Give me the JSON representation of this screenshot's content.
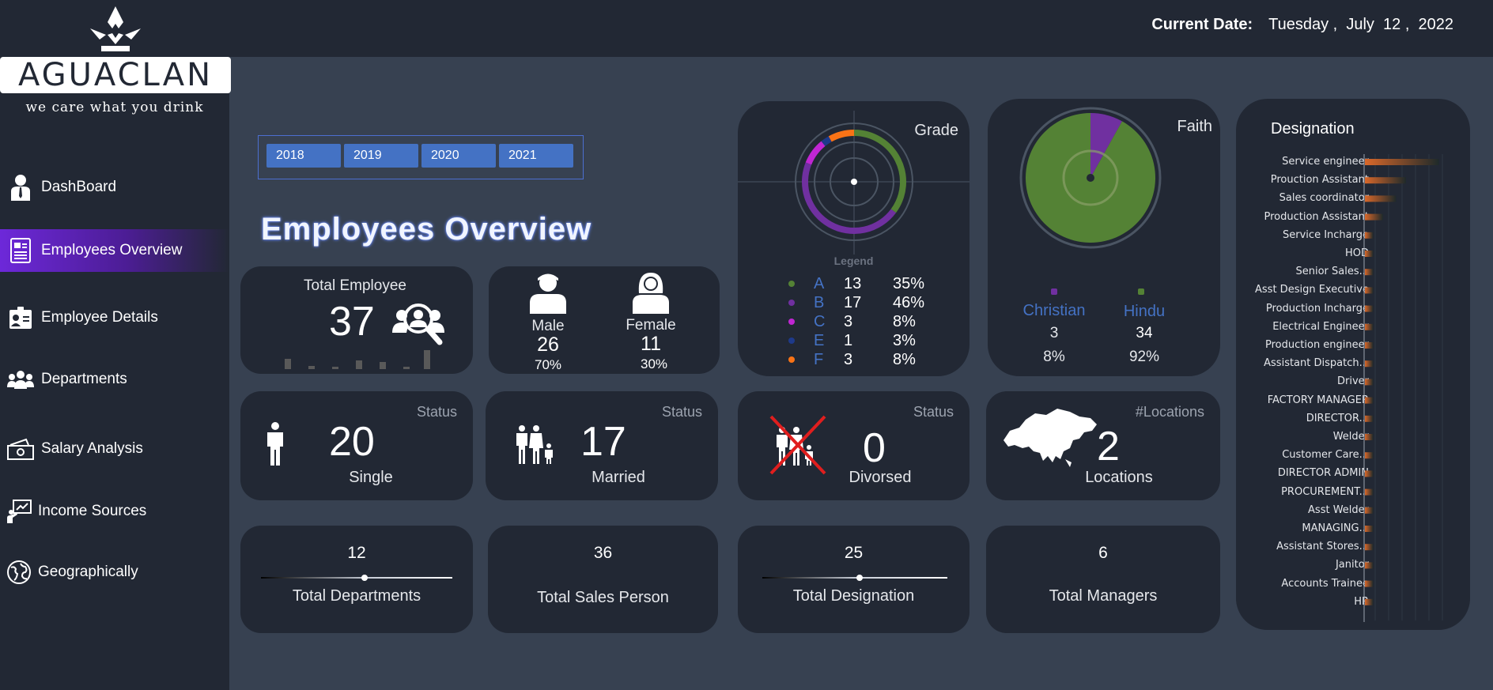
{
  "brand": {
    "name": "AGUACLAN",
    "tagline": "we care what you drink"
  },
  "header": {
    "date_label": "Current Date:",
    "date_value": "Tuesday ,  July  12 ,  2022"
  },
  "nav": [
    {
      "label": "DashBoard",
      "icon": "manager-icon"
    },
    {
      "label": "Employees Overview",
      "icon": "document-icon"
    },
    {
      "label": "Employee Details",
      "icon": "id-card-icon"
    },
    {
      "label": "Departments",
      "icon": "group-icon"
    },
    {
      "label": "Salary Analysis",
      "icon": "money-icon"
    },
    {
      "label": "Income Sources",
      "icon": "presentation-icon"
    },
    {
      "label": "Geographically",
      "icon": "globe-icon"
    }
  ],
  "years": [
    "2018",
    "2019",
    "2020",
    "2021"
  ],
  "page_title": "Employees Overview",
  "total_employee": {
    "label": "Total Employee",
    "value": "37"
  },
  "gender": {
    "male": {
      "label": "Male",
      "count": "26",
      "pct": "70%"
    },
    "female": {
      "label": "Female",
      "count": "11",
      "pct": "30%"
    }
  },
  "grade": {
    "title": "Grade",
    "legend_title": "Legend",
    "rows": [
      {
        "grade": "A",
        "count": "13",
        "pct": "35%",
        "color": "#548235"
      },
      {
        "grade": "B",
        "count": "17",
        "pct": "46%",
        "color": "#7030a0"
      },
      {
        "grade": "C",
        "count": "3",
        "pct": "8%",
        "color": "#c026d3"
      },
      {
        "grade": "E",
        "count": "1",
        "pct": "3%",
        "color": "#1e3a8a"
      },
      {
        "grade": "F",
        "count": "3",
        "pct": "8%",
        "color": "#f97316"
      }
    ]
  },
  "faith": {
    "title": "Faith",
    "items": [
      {
        "name": "Christian",
        "count": "3",
        "pct": "8%",
        "color": "#7030a0"
      },
      {
        "name": "Hindu",
        "count": "34",
        "pct": "92%",
        "color": "#548235"
      }
    ]
  },
  "status_cards": [
    {
      "status_label": "Status",
      "value": "20",
      "caption": "Single"
    },
    {
      "status_label": "Status",
      "value": "17",
      "caption": "Married"
    },
    {
      "status_label": "Status",
      "value": "0",
      "caption": "Divorsed"
    },
    {
      "status_label": "#Locations",
      "value": "2",
      "caption": "Locations"
    }
  ],
  "totals": [
    {
      "value": "12",
      "caption": "Total Departments"
    },
    {
      "value": "36",
      "caption": "Total Sales Person"
    },
    {
      "value": "25",
      "caption": "Total Designation"
    },
    {
      "value": "6",
      "caption": "Total Managers"
    }
  ],
  "designation": {
    "title": "Designation",
    "items": [
      {
        "name": "Service engineer",
        "value": 0.9
      },
      {
        "name": "Prouction Assistant",
        "value": 0.5
      },
      {
        "name": "Sales coordinator",
        "value": 0.38
      },
      {
        "name": "Production Assistant",
        "value": 0.22
      },
      {
        "name": "Service Incharge",
        "value": 0.1
      },
      {
        "name": "HOD",
        "value": 0.1
      },
      {
        "name": "Senior Sales...",
        "value": 0.1
      },
      {
        "name": "Asst Design Executive",
        "value": 0.1
      },
      {
        "name": "Production Incharge",
        "value": 0.1
      },
      {
        "name": "Electrical Engineer",
        "value": 0.1
      },
      {
        "name": "Production engineer",
        "value": 0.1
      },
      {
        "name": "Assistant Dispatch...",
        "value": 0.1
      },
      {
        "name": "Driver",
        "value": 0.1
      },
      {
        "name": "FACTORY MANAGER",
        "value": 0.1
      },
      {
        "name": "DIRECTOR...",
        "value": 0.1
      },
      {
        "name": "Welder",
        "value": 0.1
      },
      {
        "name": "Customer Care...",
        "value": 0.1
      },
      {
        "name": "DIRECTOR ADMIN",
        "value": 0.1
      },
      {
        "name": "PROCUREMENT...",
        "value": 0.1
      },
      {
        "name": "Asst Welder",
        "value": 0.1
      },
      {
        "name": "MANAGING...",
        "value": 0.1
      },
      {
        "name": "Assistant Stores...",
        "value": 0.1
      },
      {
        "name": "Janitor",
        "value": 0.1
      },
      {
        "name": "Accounts Trainee",
        "value": 0.1
      },
      {
        "name": "HR",
        "value": 0.1
      }
    ]
  }
}
